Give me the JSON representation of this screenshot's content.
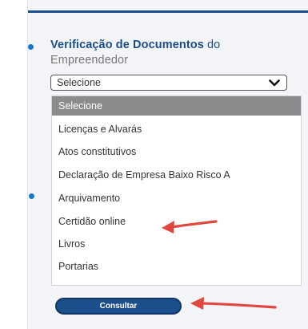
{
  "form": {
    "heading_bold": "Verificação de Documentos",
    "heading_rest": " do",
    "heading_line2": "Empreendedor",
    "select_value": "Selecione",
    "options": [
      "Selecione",
      "Licenças e Alvarás",
      "Atos constitutivos",
      "Declaração de Empresa Baixo Risco A",
      "Arquivamento",
      "Certidão online",
      "Livros",
      "Portarias"
    ],
    "selected_option": "Selecione",
    "submit_label": "Consultar"
  },
  "colors": {
    "accent": "#1b4f8c",
    "bullet": "#1479c9",
    "selected_option_bg": "#8c8c8c",
    "annotation_arrow": "#e0473f"
  },
  "icons": {
    "select_toggle": "chevron-down-icon",
    "annotation": "red-arrow-icon"
  }
}
